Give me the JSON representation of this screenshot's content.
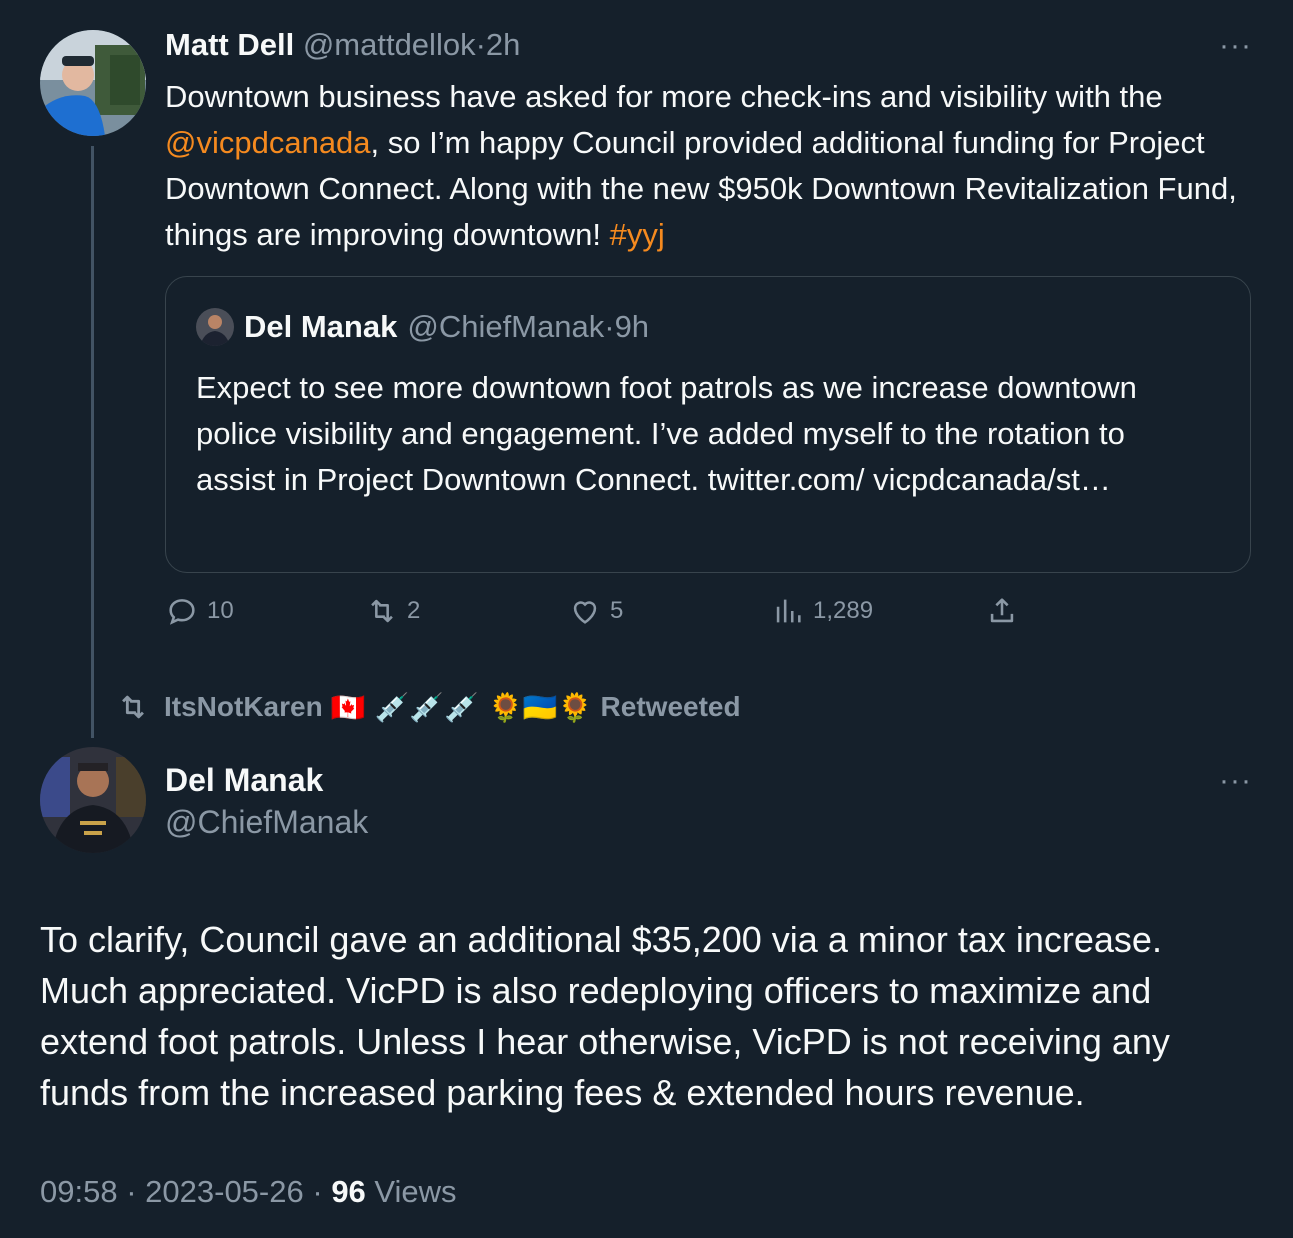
{
  "colors": {
    "background": "#15202b",
    "accent": "#f58a1f",
    "muted": "#8b98a5",
    "text": "#f7f9f9"
  },
  "tweet1": {
    "name": "Matt Dell",
    "handle": "@mattdellok",
    "sep": "·",
    "time": "2h",
    "more_icon": "more-horizontal-icon",
    "body": {
      "t1": "Downtown business have asked for more check-ins and visibility with the ",
      "mention": "@vicpdcanada",
      "t2": ", so I’m happy Council provided additional funding for Project Downtown Connect. Along with the new $950k Downtown Revitalization Fund, things are improving downtown! ",
      "hashtag": "#yyj"
    },
    "quote": {
      "name": "Del Manak",
      "handle": "@ChiefManak",
      "sep": "·",
      "time": "9h",
      "body": "Expect to see more downtown foot patrols as we increase downtown police visibility and engagement. I’ve added myself to the rotation to assist in Project Downtown Connect. twitter.com/ vicpdcanada/st…"
    },
    "actions": {
      "replies": "10",
      "retweets": "2",
      "likes": "5",
      "views": "1,289"
    }
  },
  "retweet_context": {
    "user": "ItsNotKaren",
    "emojis": "🇨🇦 💉💉💉 🌻🇺🇦🌻",
    "label": "Retweeted"
  },
  "tweet2": {
    "name": "Del Manak",
    "handle": "@ChiefManak",
    "more_icon": "more-horizontal-icon",
    "body": "To clarify, Council gave an additional $35,200 via a minor tax increase. Much appreciated. VicPD is also redeploying officers to maximize and extend foot patrols. Unless I hear otherwise, VicPD is not receiving any funds from the increased parking fees & extended hours revenue.",
    "time": "09:58",
    "sep": "·",
    "date": "2023-05-26",
    "views_count": "96",
    "views_label": "Views"
  }
}
